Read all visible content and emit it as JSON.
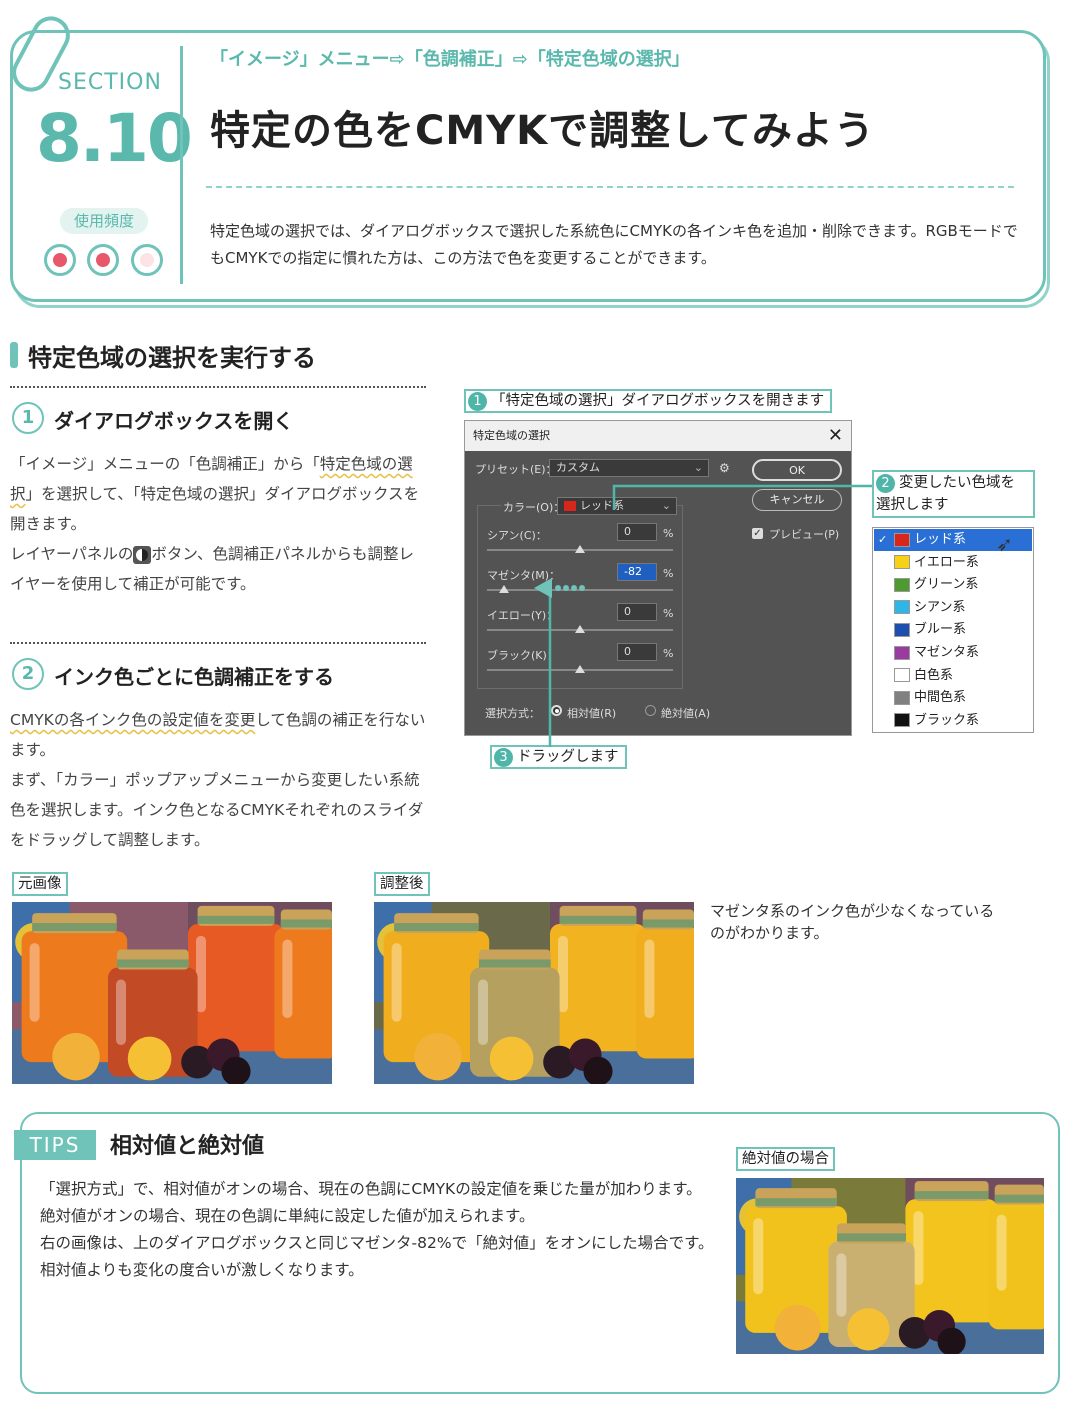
{
  "header": {
    "section_word": "SECTION",
    "section_number": "8.10",
    "frequency_label": "使用頻度",
    "frequency_level": "2 of 3",
    "breadcrumb": "「イメージ」メニュー⇨「色調補正」⇨「特定色域の選択」",
    "title": "特定の色をCMYKで調整してみよう",
    "intro": "特定色域の選択では、ダイアログボックスで選択した系統色にCMYKの各インキ色を追加・削除できます。RGBモードでもCMYKでの指定に慣れた方は、この方法で色を変更することができます。"
  },
  "section": {
    "title": "特定色域の選択を実行する"
  },
  "step1": {
    "number": "1",
    "heading": "ダイアログボックスを開く",
    "p1_a": "「イメージ」メニューの「色調補正」から「",
    "p1_u": "特定色域の選択",
    "p1_b": "」を選択して、「特定色域の選択」ダイアログボックスを開きます。",
    "p2_a": "レイヤーパネルの",
    "p2_b": "ボタン、色調補正パネルからも調整レイヤーを使用して補正が可能です。"
  },
  "step2": {
    "number": "2",
    "heading": "インク色ごとに色調補正をする",
    "p1_u": "CMYKの各インク色の設定値を変更",
    "p1_b": "して色調の補正を行ないます。",
    "p2": "まず、「カラー」ポップアップメニューから変更したい系統色を選択します。インク色となるCMYKそれぞれのスライダをドラッグして調整します。"
  },
  "callouts": {
    "c1_num": "1",
    "c1": "「特定色域の選択」ダイアログボックスを開きます",
    "c2_num": "2",
    "c2": "変更したい色域を選択します",
    "c3_num": "3",
    "c3": "ドラッグします"
  },
  "dialog": {
    "title": "特定色域の選択",
    "close": "✕",
    "preset_label": "プリセット(E)：",
    "preset_value": "カスタム",
    "color_label": "カラー(O)：",
    "color_value": "レッド系",
    "ok": "OK",
    "cancel": "キャンセル",
    "preview": "プレビュー(P)",
    "preview_checked": true,
    "sliders": [
      {
        "label": "シアン(C)：",
        "value": "0",
        "unit": "%",
        "level": 0
      },
      {
        "label": "マゼンタ(M)：",
        "value": "-82",
        "unit": "%",
        "level": -82
      },
      {
        "label": "イエロー(Y)：",
        "value": "0",
        "unit": "%",
        "level": 0
      },
      {
        "label": "ブラック(K)：",
        "value": "0",
        "unit": "%",
        "level": 0
      }
    ],
    "method_label": "選択方式：",
    "relative": "相対値(R)",
    "absolute": "絶対値(A)",
    "selected_method": "relative"
  },
  "color_list": [
    {
      "label": "レッド系",
      "color": "#d7261c",
      "selected": true
    },
    {
      "label": "イエロー系",
      "color": "#f7d117"
    },
    {
      "label": "グリーン系",
      "color": "#4f9a2e"
    },
    {
      "label": "シアン系",
      "color": "#2fb6e8"
    },
    {
      "label": "ブルー系",
      "color": "#1f4fae"
    },
    {
      "label": "マゼンタ系",
      "color": "#9b3aa0"
    },
    {
      "label": "白色系",
      "color": "#ffffff"
    },
    {
      "label": "中間色系",
      "color": "#808080"
    },
    {
      "label": "ブラック系",
      "color": "#111111"
    }
  ],
  "photos": {
    "before_label": "元画像",
    "after_label": "調整後",
    "caption": "マゼンタ系のインク色が少なくなっているのがわかります。"
  },
  "tips": {
    "tag": "TIPS",
    "title": "相対値と絶対値",
    "p1": "「選択方式」で、相対値がオンの場合、現在の色調にCMYKの設定値を乗じた量が加わります。",
    "p2": "絶対値がオンの場合、現在の色調に単純に設定した値が加えられます。",
    "p3": "右の画像は、上のダイアログボックスと同じマゼンタ-82%で「絶対値」をオンにした場合です。相対値よりも変化の度合いが激しくなります。",
    "image_label": "絶対値の場合"
  },
  "colors": {
    "accent": "#6fc3b8",
    "accent_text": "#5ab8ad",
    "frequency_dot": "#e8586b",
    "highlight_underline": "#e6c24a"
  }
}
